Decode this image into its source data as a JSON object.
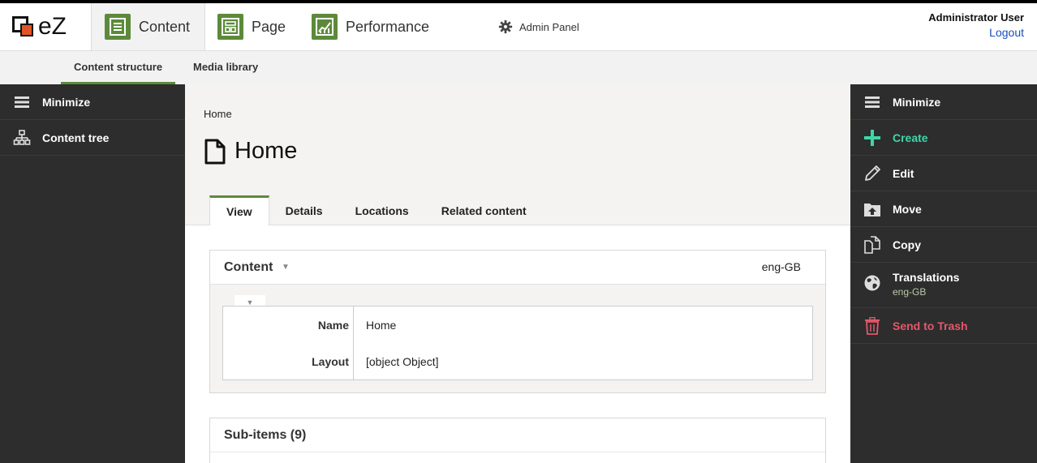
{
  "app": {
    "logo_text": "eZ"
  },
  "header": {
    "tabs": [
      {
        "label": "Content",
        "icon": "content-icon"
      },
      {
        "label": "Page",
        "icon": "page-icon"
      },
      {
        "label": "Performance",
        "icon": "performance-icon"
      }
    ],
    "admin_panel_label": "Admin Panel",
    "user_name": "Administrator User",
    "logout_label": "Logout"
  },
  "subnav": {
    "items": [
      {
        "label": "Content structure",
        "active": true
      },
      {
        "label": "Media library",
        "active": false
      }
    ]
  },
  "left_sidebar": {
    "items": [
      {
        "label": "Minimize",
        "icon": "hamburger-icon"
      },
      {
        "label": "Content tree",
        "icon": "tree-icon"
      }
    ]
  },
  "main": {
    "breadcrumb": "Home",
    "title": "Home",
    "tabs": [
      "View",
      "Details",
      "Locations",
      "Related content"
    ],
    "content_panel": {
      "title": "Content",
      "language": "eng-GB",
      "fields": [
        {
          "label": "Name",
          "value": "Home"
        },
        {
          "label": "Layout",
          "value": "[object Object]"
        }
      ]
    },
    "subitems_panel": {
      "title": "Sub-items (9)"
    }
  },
  "right_sidebar": {
    "items": [
      {
        "label": "Minimize",
        "icon": "hamburger-icon"
      },
      {
        "label": "Create",
        "icon": "plus-icon",
        "color": "#3fd6a8"
      },
      {
        "label": "Edit",
        "icon": "pencil-icon"
      },
      {
        "label": "Move",
        "icon": "folder-move-icon"
      },
      {
        "label": "Copy",
        "icon": "copy-icon"
      },
      {
        "label": "Translations",
        "sub": "eng-GB",
        "icon": "globe-icon"
      },
      {
        "label": "Send to Trash",
        "icon": "trash-icon",
        "color": "#e4586a"
      }
    ]
  },
  "colors": {
    "accent_green": "#5d8a3a",
    "sidebar_bg": "#2d2d2d",
    "create_color": "#3fd6a8",
    "trash_color": "#e4586a",
    "link_blue": "#1a4fbf"
  }
}
